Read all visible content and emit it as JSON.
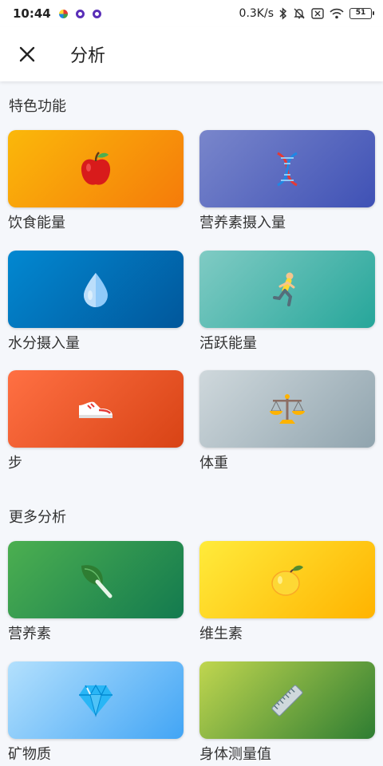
{
  "status_bar": {
    "time": "10:44",
    "network_speed": "0.3K/s",
    "battery_level": "51",
    "icons": [
      "bluetooth-icon",
      "mute-bell-icon",
      "sim-off-icon",
      "wifi-icon",
      "battery-icon"
    ]
  },
  "header": {
    "title": "分析",
    "close_icon": "close-icon"
  },
  "sections": [
    {
      "title": "特色功能",
      "cards": [
        {
          "label": "饮食能量",
          "icon": "apple-icon",
          "colors": [
            "#fbb80a",
            "#f57b0a"
          ]
        },
        {
          "label": "营养素摄入量",
          "icon": "dna-icon",
          "colors": [
            "#7986cb",
            "#3f51b5"
          ]
        },
        {
          "label": "水分摄入量",
          "icon": "water-drop-icon",
          "colors": [
            "#0288d1",
            "#01579b"
          ]
        },
        {
          "label": "活跃能量",
          "icon": "running-person-icon",
          "colors": [
            "#80cbc4",
            "#26a69a"
          ]
        },
        {
          "label": "步",
          "icon": "sneaker-icon",
          "colors": [
            "#ff7043",
            "#d84315"
          ]
        },
        {
          "label": "体重",
          "icon": "balance-scale-icon",
          "colors": [
            "#cfd8dc",
            "#90a4ae"
          ]
        }
      ]
    },
    {
      "title": "更多分析",
      "cards": [
        {
          "label": "营养素",
          "icon": "leafy-green-icon",
          "colors": [
            "#4caf50",
            "#137a4f"
          ]
        },
        {
          "label": "维生素",
          "icon": "lemon-icon",
          "colors": [
            "#ffeb3b",
            "#ffb300"
          ]
        },
        {
          "label": "矿物质",
          "icon": "gem-icon",
          "colors": [
            "#b3e0fd",
            "#42a5f5"
          ]
        },
        {
          "label": "身体测量值",
          "icon": "ruler-icon",
          "colors": [
            "#c0d64f",
            "#2e7d32"
          ]
        }
      ]
    }
  ]
}
